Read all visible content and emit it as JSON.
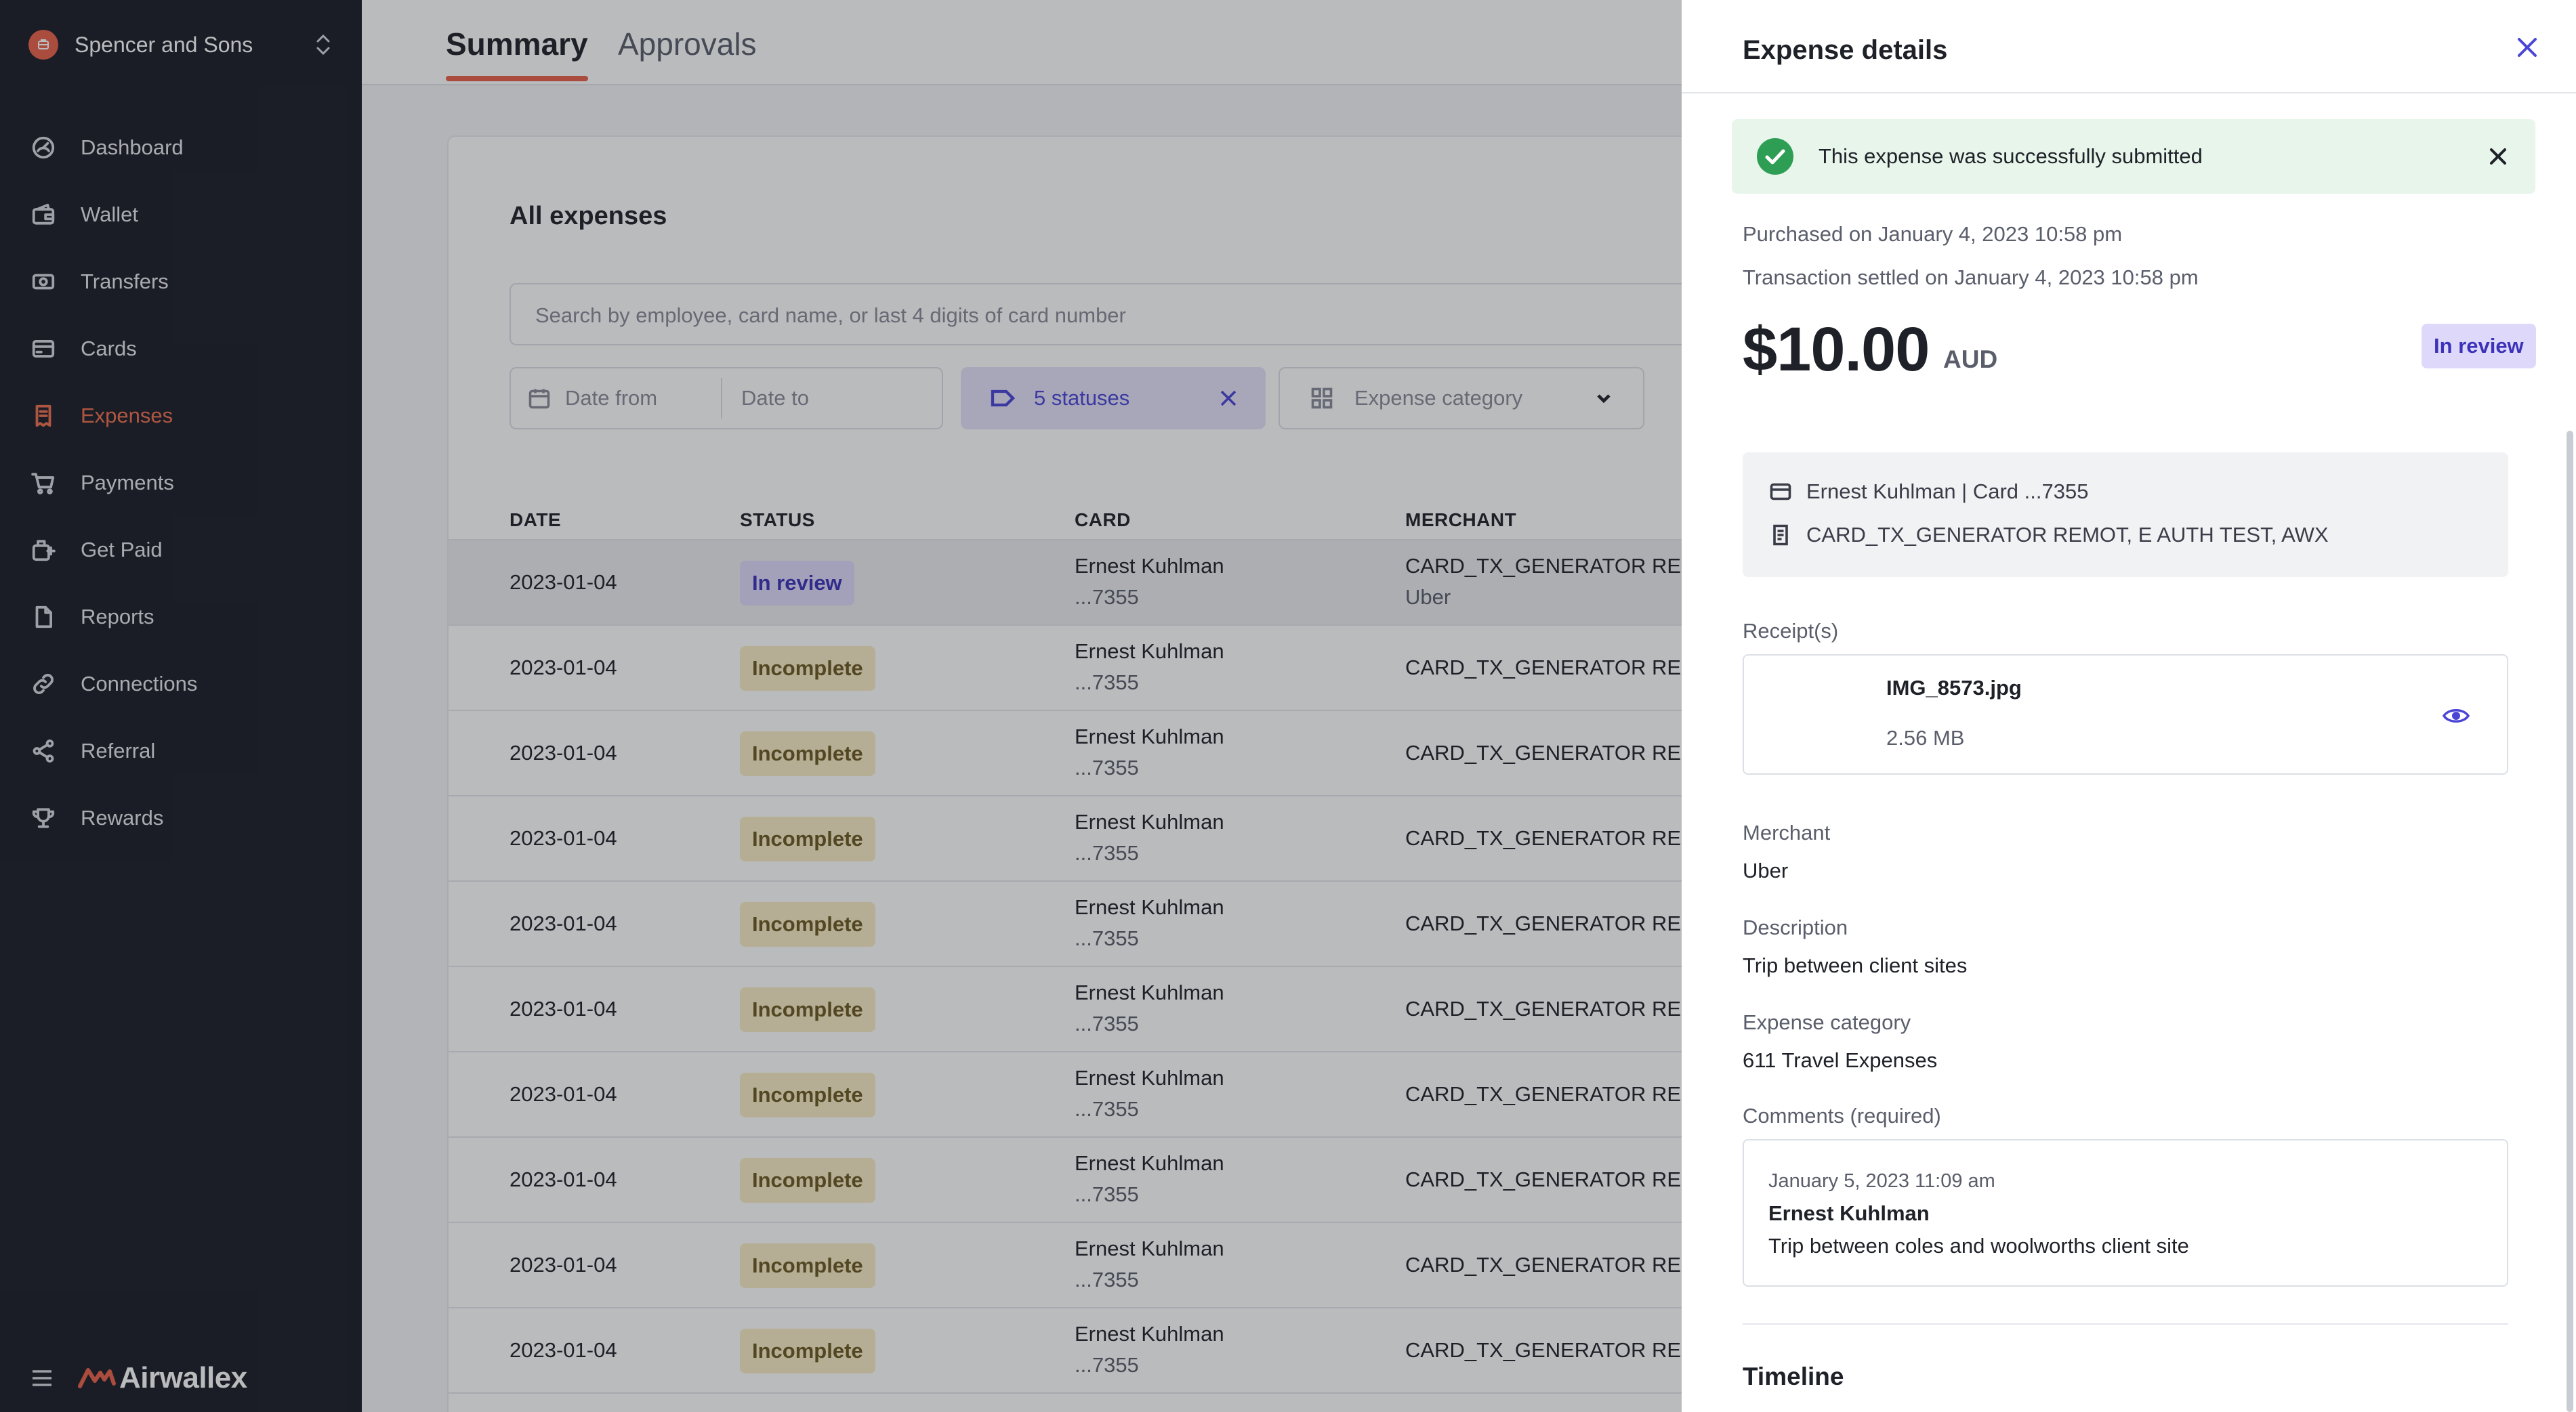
{
  "sidebar": {
    "org_name": "Spencer and Sons",
    "items": [
      {
        "label": "Dashboard",
        "icon": "dashboard-icon"
      },
      {
        "label": "Wallet",
        "icon": "wallet-icon"
      },
      {
        "label": "Transfers",
        "icon": "transfers-icon"
      },
      {
        "label": "Cards",
        "icon": "card-icon"
      },
      {
        "label": "Expenses",
        "icon": "expenses-icon",
        "active": true
      },
      {
        "label": "Payments",
        "icon": "cart-icon"
      },
      {
        "label": "Get Paid",
        "icon": "get-paid-icon"
      },
      {
        "label": "Reports",
        "icon": "report-icon"
      },
      {
        "label": "Connections",
        "icon": "link-icon"
      },
      {
        "label": "Referral",
        "icon": "share-icon"
      },
      {
        "label": "Rewards",
        "icon": "trophy-icon"
      }
    ],
    "brand": "Airwallex"
  },
  "tabs": [
    {
      "label": "Summary",
      "active": true
    },
    {
      "label": "Approvals",
      "active": false
    }
  ],
  "expenses": {
    "title": "All expenses",
    "search_placeholder": "Search by employee, card name, or last 4 digits of card number",
    "filters": {
      "date_from": "Date from",
      "date_to": "Date to",
      "statuses": "5 statuses",
      "category": "Expense category"
    },
    "columns": [
      "DATE",
      "STATUS",
      "CARD",
      "MERCHANT"
    ],
    "rows": [
      {
        "date": "2023-01-04",
        "status": "In review",
        "card_name": "Ernest Kuhlman",
        "card_num": "...7355",
        "merchant": "CARD_TX_GENERATOR REMOT",
        "merchant_sub": "Uber"
      },
      {
        "date": "2023-01-04",
        "status": "Incomplete",
        "card_name": "Ernest Kuhlman",
        "card_num": "...7355",
        "merchant": "CARD_TX_GENERATOR REMOT"
      },
      {
        "date": "2023-01-04",
        "status": "Incomplete",
        "card_name": "Ernest Kuhlman",
        "card_num": "...7355",
        "merchant": "CARD_TX_GENERATOR REMOT"
      },
      {
        "date": "2023-01-04",
        "status": "Incomplete",
        "card_name": "Ernest Kuhlman",
        "card_num": "...7355",
        "merchant": "CARD_TX_GENERATOR REMOT"
      },
      {
        "date": "2023-01-04",
        "status": "Incomplete",
        "card_name": "Ernest Kuhlman",
        "card_num": "...7355",
        "merchant": "CARD_TX_GENERATOR REMOT"
      },
      {
        "date": "2023-01-04",
        "status": "Incomplete",
        "card_name": "Ernest Kuhlman",
        "card_num": "...7355",
        "merchant": "CARD_TX_GENERATOR REMOT"
      },
      {
        "date": "2023-01-04",
        "status": "Incomplete",
        "card_name": "Ernest Kuhlman",
        "card_num": "...7355",
        "merchant": "CARD_TX_GENERATOR REMOT"
      },
      {
        "date": "2023-01-04",
        "status": "Incomplete",
        "card_name": "Ernest Kuhlman",
        "card_num": "...7355",
        "merchant": "CARD_TX_GENERATOR REMOT"
      },
      {
        "date": "2023-01-04",
        "status": "Incomplete",
        "card_name": "Ernest Kuhlman",
        "card_num": "...7355",
        "merchant": "CARD_TX_GENERATOR REMOT"
      },
      {
        "date": "2023-01-04",
        "status": "Incomplete",
        "card_name": "Ernest Kuhlman",
        "card_num": "...7355",
        "merchant": "CARD_TX_GENERATOR REMOT"
      }
    ]
  },
  "drawer": {
    "title": "Expense details",
    "alert": "This expense was successfully submitted",
    "purchased": "Purchased on January 4, 2023 10:58 pm",
    "settled": "Transaction settled on January 4, 2023 10:58 pm",
    "amount": "$10.00",
    "currency": "AUD",
    "status": "In review",
    "card_line": "Ernest Kuhlman | Card ...7355",
    "merchant_line": "CARD_TX_GENERATOR REMOT, E AUTH TEST, AWX",
    "receipts_label": "Receipt(s)",
    "receipt_name": "IMG_8573.jpg",
    "receipt_size": "2.56 MB",
    "merchant_label": "Merchant",
    "merchant_value": "Uber",
    "description_label": "Description",
    "description_value": "Trip between client sites",
    "category_label": "Expense category",
    "category_value": "611 Travel Expenses",
    "comments_label": "Comments (required)",
    "comment": {
      "date": "January 5, 2023 11:09 am",
      "author": "Ernest Kuhlman",
      "text": "Trip between coles and woolworths client site"
    },
    "timeline_label": "Timeline"
  },
  "colors": {
    "sidebar_bg": "#1b1e27",
    "accent": "#e8614a",
    "primary": "#4a45d6",
    "review_bg": "#ded9fb",
    "incomplete_bg": "#f8ecc4",
    "success_bg": "#e7f5ea"
  }
}
